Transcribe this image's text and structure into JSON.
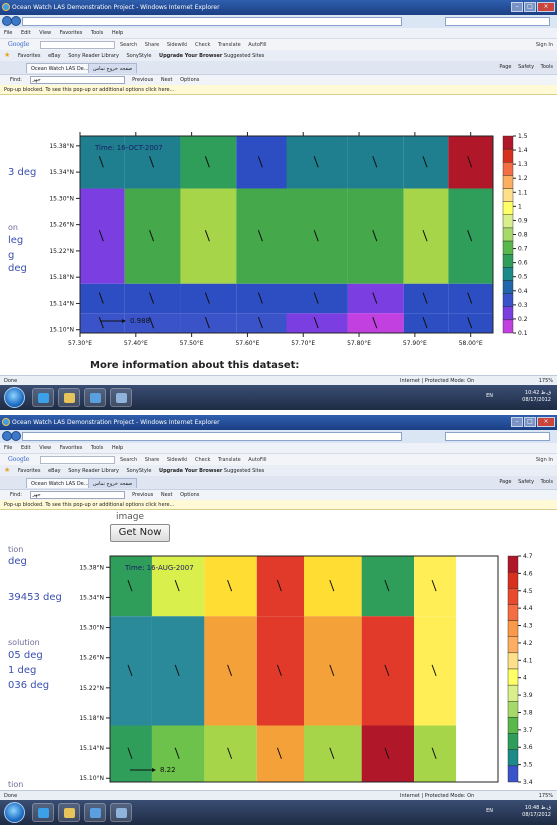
{
  "browser": {
    "title": "Ocean Watch LAS Demonstration Project - Windows Internet Explorer",
    "favorites_label": "Favorites",
    "fav_items": [
      "eBay",
      "Sony Reader Library",
      "SonyStyle"
    ],
    "fav_upgrade": "Upgrade Your Browser",
    "fav_suggested": "Suggested Sites",
    "menu": [
      "File",
      "Edit",
      "View",
      "Favorites",
      "Tools",
      "Help"
    ],
    "google_label": "Google",
    "google_items": [
      "Search",
      "Share",
      "Sidewiki",
      "Check",
      "Translate",
      "AutoFill"
    ],
    "google_signin": "Sign In",
    "tab_active": "Ocean Watch LAS De...",
    "tab_inactive": "صفحه خروج تماس",
    "cmd_items": [
      "Page",
      "Safety",
      "Tools"
    ],
    "find_label": "Find:",
    "find_value": "جهز",
    "find_prev": "Previous",
    "find_next": "Next",
    "find_options": "Options",
    "popup_message": "Pop-up blocked. To see this pop-up or additional options click here...",
    "status_done": "Done",
    "status_zone": "Internet | Protected Mode: On",
    "zoom": "175%",
    "lang": "EN",
    "shot1_clock": [
      "10:42 ق.ظ",
      "08/17/2012"
    ],
    "shot2_clock": [
      "10:48 ق.ظ",
      "08/17/2012"
    ]
  },
  "shot1": {
    "side_labels": [
      "3 deg",
      "on",
      "leg",
      "g",
      "deg"
    ],
    "footer_text": "More information about this dataset:"
  },
  "shot2": {
    "image_label": "image",
    "get_now": "Get Now",
    "side_labels": [
      "tion",
      "deg",
      "39453 deg",
      "solution",
      "05 deg",
      "1 deg",
      "036 deg",
      "tion"
    ]
  },
  "chart_data": [
    {
      "type": "heatmap",
      "title": "Time: 16-OCT-2007",
      "x_ticks": [
        "57.30°E",
        "57.40°E",
        "57.50°E",
        "57.60°E",
        "57.70°E",
        "57.80°E",
        "57.90°E",
        "58.00°E"
      ],
      "y_ticks": [
        "15.38°N",
        "15.34°N",
        "15.30°N",
        "15.26°N",
        "15.22°N",
        "15.18°N",
        "15.14°N",
        "15.10°N"
      ],
      "colorbar_ticks": [
        "1.5",
        "1.4",
        "1.3",
        "1.2",
        "1.1",
        "1",
        "0.9",
        "0.8",
        "0.7",
        "0.6",
        "0.5",
        "0.4",
        "0.3",
        "0.2",
        "0.1"
      ],
      "colorbar_colors": [
        "#b0182a",
        "#d7301f",
        "#f46d43",
        "#fdae61",
        "#fee08b",
        "#ffff66",
        "#d9ef8b",
        "#a6d96a",
        "#5ab84a",
        "#2e9e5a",
        "#1d8a8a",
        "#2166ac",
        "#3a53c9",
        "#7b3ee0",
        "#c23fe0"
      ],
      "vector_scale": "0.988",
      "columns": [
        {
          "x_from": 57.3,
          "x_to": 57.38,
          "cells": [
            "#1f7f8f",
            "#7b3ee0",
            "#2c4ec2",
            "#3a53c9"
          ]
        },
        {
          "x_from": 57.38,
          "x_to": 57.48,
          "cells": [
            "#1f7f8f",
            "#45a84a",
            "#2c4ec2",
            "#3a53c9"
          ]
        },
        {
          "x_from": 57.48,
          "x_to": 57.58,
          "cells": [
            "#2e9e5a",
            "#a7d54a",
            "#2c4ec2",
            "#3a53c9"
          ]
        },
        {
          "x_from": 57.58,
          "x_to": 57.67,
          "cells": [
            "#2c4ec2",
            "#45a84a",
            "#2c4ec2",
            "#3a53c9"
          ]
        },
        {
          "x_from": 57.67,
          "x_to": 57.78,
          "cells": [
            "#1f7f8f",
            "#45a84a",
            "#2c4ec2",
            "#7b3ee0"
          ]
        },
        {
          "x_from": 57.78,
          "x_to": 57.88,
          "cells": [
            "#1f7f8f",
            "#45a84a",
            "#7b3ee0",
            "#c23fe0"
          ]
        },
        {
          "x_from": 57.88,
          "x_to": 57.96,
          "cells": [
            "#1f7f8f",
            "#a7d54a",
            "#2c4ec2",
            "#2c4ec2"
          ]
        },
        {
          "x_from": 57.96,
          "x_to": 58.04,
          "cells": [
            "#b0182a",
            "#2e9e5a",
            "#2c4ec2",
            "#2c4ec2"
          ]
        }
      ],
      "row_bounds": [
        15.395,
        15.315,
        15.17,
        15.125,
        15.095
      ]
    },
    {
      "type": "heatmap",
      "title": "Time: 16-AUG-2007",
      "x_ticks": [],
      "y_ticks": [
        "15.38°N",
        "15.34°N",
        "15.30°N",
        "15.26°N",
        "15.22°N",
        "15.18°N",
        "15.14°N",
        "15.10°N"
      ],
      "colorbar_ticks": [
        "4.7",
        "4.6",
        "4.5",
        "4.4",
        "4.3",
        "4.2",
        "4.1",
        "4",
        "3.9",
        "3.8",
        "3.7",
        "3.6",
        "3.5",
        "3.4"
      ],
      "colorbar_colors": [
        "#b0182a",
        "#d7301f",
        "#e84a2e",
        "#f46d43",
        "#f99a4a",
        "#fdae61",
        "#fee08b",
        "#ffff66",
        "#d9ef8b",
        "#a6d96a",
        "#5ab84a",
        "#2e9e5a",
        "#1d8a8a",
        "#3a53c9"
      ],
      "vector_scale": "8.22",
      "columns": [
        {
          "x_from": 57.3,
          "x_to": 57.38,
          "cells": [
            "#2e9e5a",
            "#2a8a9a",
            "#2e9e5a"
          ]
        },
        {
          "x_from": 57.38,
          "x_to": 57.48,
          "cells": [
            "#d9ef4b",
            "#2a8a9a",
            "#6cc24a"
          ]
        },
        {
          "x_from": 57.48,
          "x_to": 57.58,
          "cells": [
            "#ffdd33",
            "#f5a13a",
            "#a7d54a"
          ]
        },
        {
          "x_from": 57.58,
          "x_to": 57.67,
          "cells": [
            "#e23a2a",
            "#e23a2a",
            "#f5a13a"
          ]
        },
        {
          "x_from": 57.67,
          "x_to": 57.78,
          "cells": [
            "#ffdd33",
            "#f5a13a",
            "#a7d54a"
          ]
        },
        {
          "x_from": 57.78,
          "x_to": 57.88,
          "cells": [
            "#2e9e5a",
            "#e23a2a",
            "#b0182a"
          ]
        },
        {
          "x_from": 57.88,
          "x_to": 57.96,
          "cells": [
            "#ffee55",
            "#ffee55",
            "#a7d54a"
          ]
        }
      ],
      "row_bounds": [
        15.395,
        15.315,
        15.17,
        15.095
      ]
    }
  ]
}
